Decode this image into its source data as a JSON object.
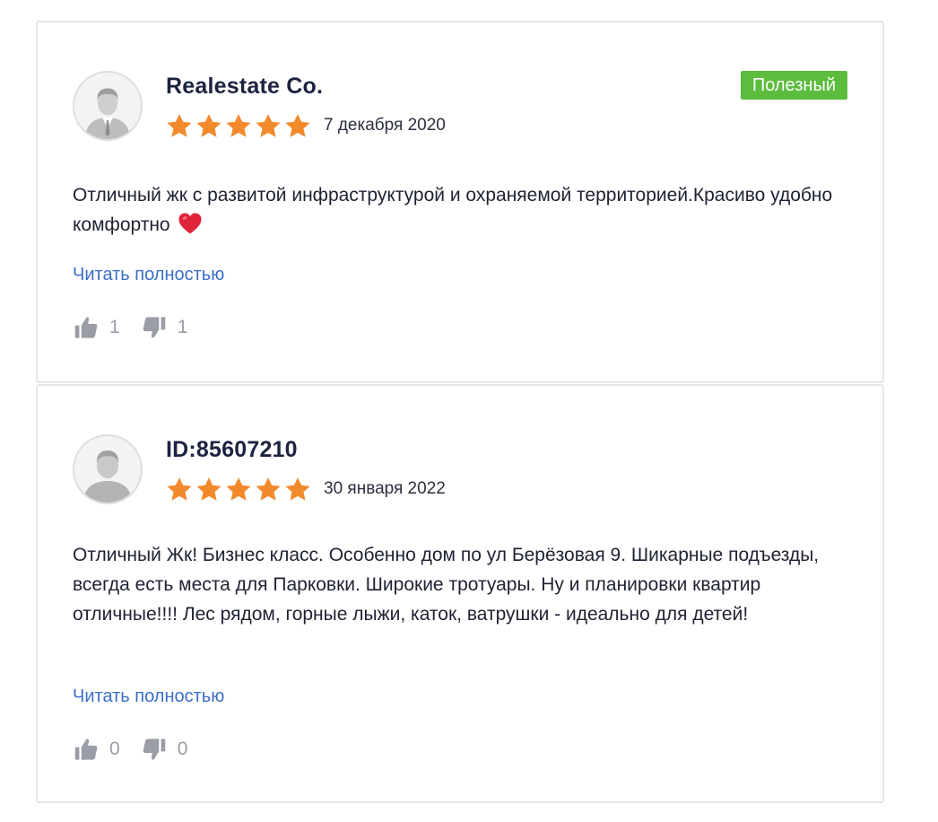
{
  "reviews": [
    {
      "author": "Realestate Co.",
      "rating": 5,
      "date": "7 декабря 2020",
      "badge": "Полезный",
      "text": "Отличный жк с развитой инфраструктурой и охраняемой территорией.Красиво удобно комфортно",
      "emoji": "heart-icon",
      "read_more": "Читать полностью",
      "likes": "1",
      "dislikes": "1"
    },
    {
      "author": "ID:85607210",
      "rating": 5,
      "date": "30 января 2022",
      "text": "Отличный Жк! Бизнес класс. Особенно дом по ул Берёзовая 9. Шикарные подъезды, всегда есть места для Парковки. Широкие тротуары. Ну и планировки квартир отличные!!!! Лес рядом, горные лыжи, каток, ватрушки - идеально для детей!",
      "read_more": "Читать полностью",
      "likes": "0",
      "dislikes": "0"
    }
  ],
  "colors": {
    "star": "#f28a2c",
    "badge_bg": "#5cbc3d",
    "link": "#3b6fc7",
    "vote": "#9a9da6",
    "author": "#1c2340",
    "card_border": "#e6e7ea",
    "heart": "#e0243a"
  },
  "icons": {
    "star": "star-icon",
    "like": "thumbs-up-icon",
    "dislike": "thumbs-down-icon",
    "avatar_0": "avatar-businessman-icon",
    "avatar_1": "avatar-person-icon"
  }
}
